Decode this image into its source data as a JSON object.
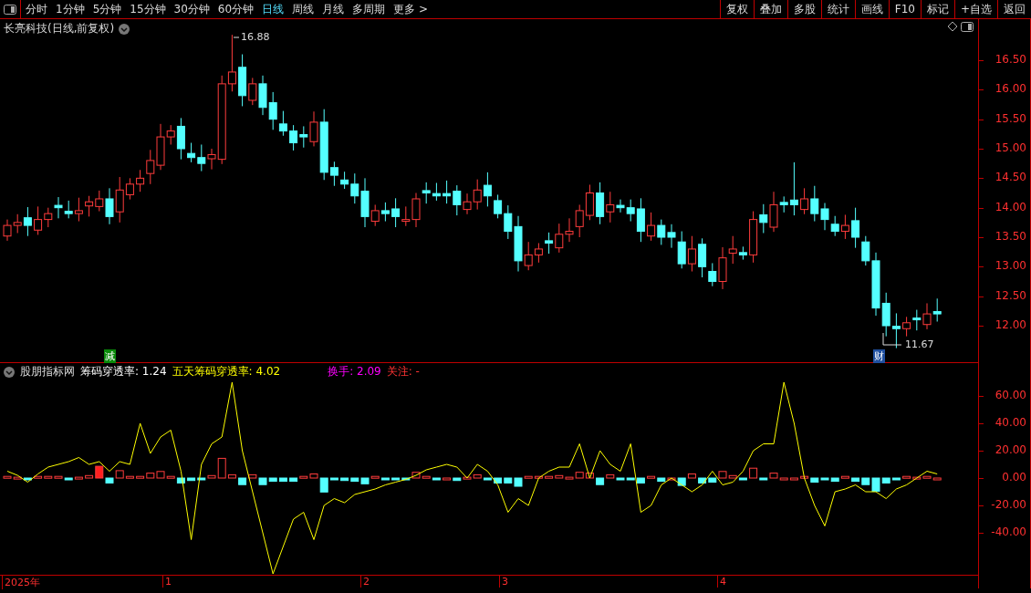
{
  "toolbar": {
    "periods": [
      {
        "label": "分时",
        "selected": false
      },
      {
        "label": "1分钟",
        "selected": false
      },
      {
        "label": "5分钟",
        "selected": false
      },
      {
        "label": "15分钟",
        "selected": false
      },
      {
        "label": "30分钟",
        "selected": false
      },
      {
        "label": "60分钟",
        "selected": false
      },
      {
        "label": "日线",
        "selected": true
      },
      {
        "label": "周线",
        "selected": false
      },
      {
        "label": "月线",
        "selected": false
      },
      {
        "label": "多周期",
        "selected": false
      },
      {
        "label": "更多 >",
        "selected": false
      }
    ],
    "buttons": [
      "复权",
      "叠加",
      "多股",
      "统计",
      "画线",
      "F10",
      "标记",
      "+自选",
      "返回"
    ]
  },
  "main_chart": {
    "title": "长亮科技(日线,前复权)",
    "high_label": "16.88",
    "low_label": "11.67",
    "marks": [
      {
        "text": "减",
        "kind": "reduce"
      },
      {
        "text": "财",
        "kind": "finance"
      }
    ],
    "y_labels": [
      "16.50",
      "16.00",
      "15.50",
      "15.00",
      "14.50",
      "14.00",
      "13.50",
      "13.00",
      "12.50",
      "12.00"
    ]
  },
  "indicator": {
    "name": "股朋指标网",
    "left_readouts": [
      {
        "text": "筹码穿透率: 1.24",
        "color": "#ffffff"
      },
      {
        "text": "五天筹码穿透率: 4.02",
        "color": "#ffff00"
      }
    ],
    "right_readouts": [
      {
        "text": "换手: 2.09",
        "color": "#ff00ff"
      },
      {
        "text": "关注: -",
        "color": "#ff3333"
      }
    ],
    "y_labels": [
      "60.00",
      "40.00",
      "20.00",
      "0.00",
      "-20.00",
      "-40.00"
    ]
  },
  "time_axis": {
    "labels": [
      "2025年",
      "1",
      "2",
      "3",
      "4"
    ]
  }
}
